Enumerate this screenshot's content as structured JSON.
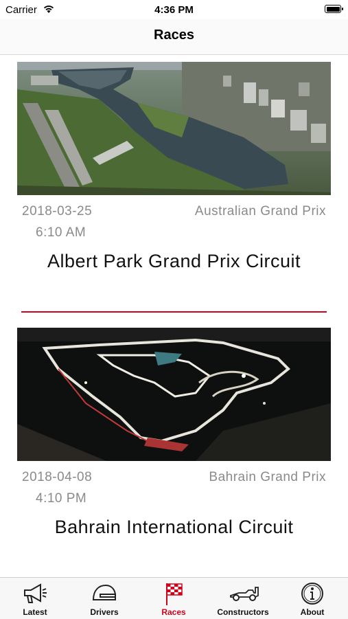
{
  "status_bar": {
    "carrier": "Carrier",
    "time": "4:36 PM"
  },
  "nav": {
    "title": "Races"
  },
  "races": [
    {
      "date": "2018-03-25",
      "time": "6:10 AM",
      "race_name": "Australian Grand Prix",
      "circuit": "Albert Park Grand Prix Circuit"
    },
    {
      "date": "2018-04-08",
      "time": "4:10 PM",
      "race_name": "Bahrain Grand Prix",
      "circuit": "Bahrain International Circuit"
    }
  ],
  "tabs": [
    {
      "label": "Latest",
      "icon": "megaphone-icon"
    },
    {
      "label": "Drivers",
      "icon": "helmet-icon"
    },
    {
      "label": "Races",
      "icon": "checkered-flag-icon",
      "active": true
    },
    {
      "label": "Constructors",
      "icon": "race-car-icon"
    },
    {
      "label": "About",
      "icon": "info-icon"
    }
  ],
  "colors": {
    "accent": "#d0021b",
    "secondary_text": "#8a8a8a"
  }
}
